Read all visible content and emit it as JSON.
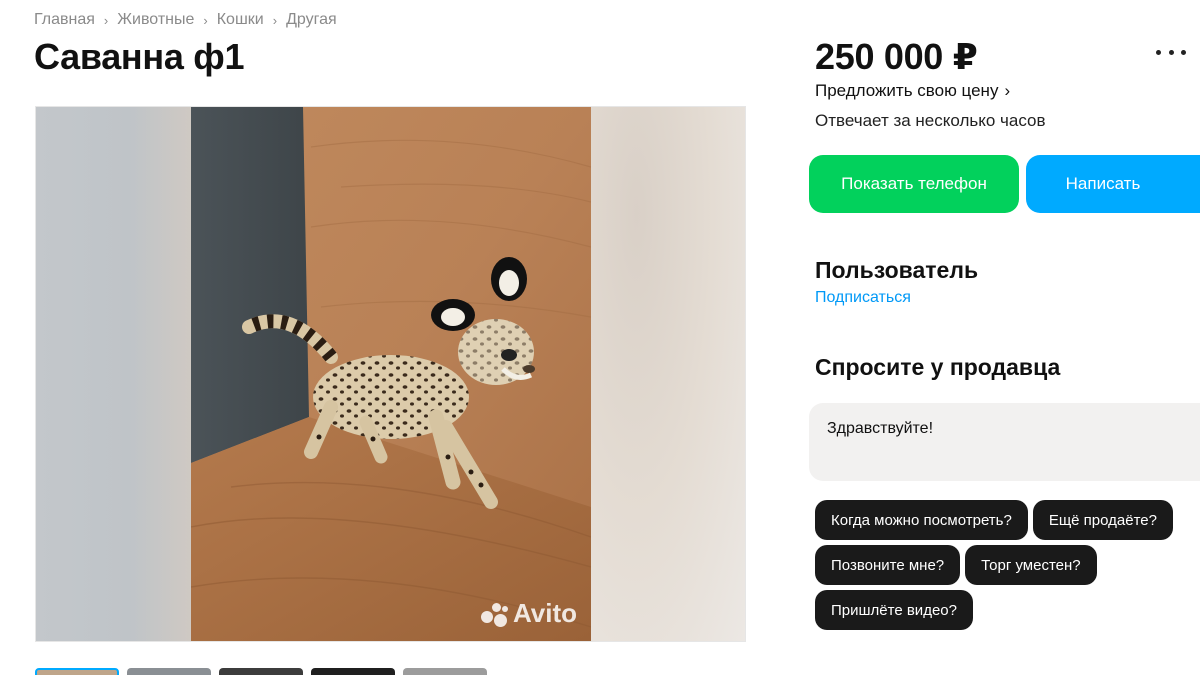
{
  "breadcrumbs": [
    "Главная",
    "Животные",
    "Кошки",
    "Другая"
  ],
  "listing": {
    "title": "Саванна ф1",
    "price": "250 000 ₽",
    "offer_price": "Предложить свою цену",
    "response_time": "Отвечает за несколько часов"
  },
  "actions": {
    "show_phone": "Показать телефон",
    "write": "Написать"
  },
  "seller": {
    "name": "Пользователь",
    "subscribe": "Подписаться"
  },
  "ask": {
    "title": "Спросите у продавца",
    "message": "Здравствуйте!",
    "quick_questions": [
      "Когда можно посмотреть?",
      "Ещё продаёте?",
      "Позвоните мне?",
      "Торг уместен?",
      "Пришлёте видео?"
    ]
  },
  "gallery": {
    "watermark": "Avito",
    "photo_subject": "serval kitten on wooden floor",
    "thumbnail_count": 5
  },
  "colors": {
    "phone_button": "#02d15c",
    "write_button": "#00aaff",
    "link": "#0099f7",
    "chip": "#1a1a1a",
    "input_bg": "#f2f1f0"
  }
}
